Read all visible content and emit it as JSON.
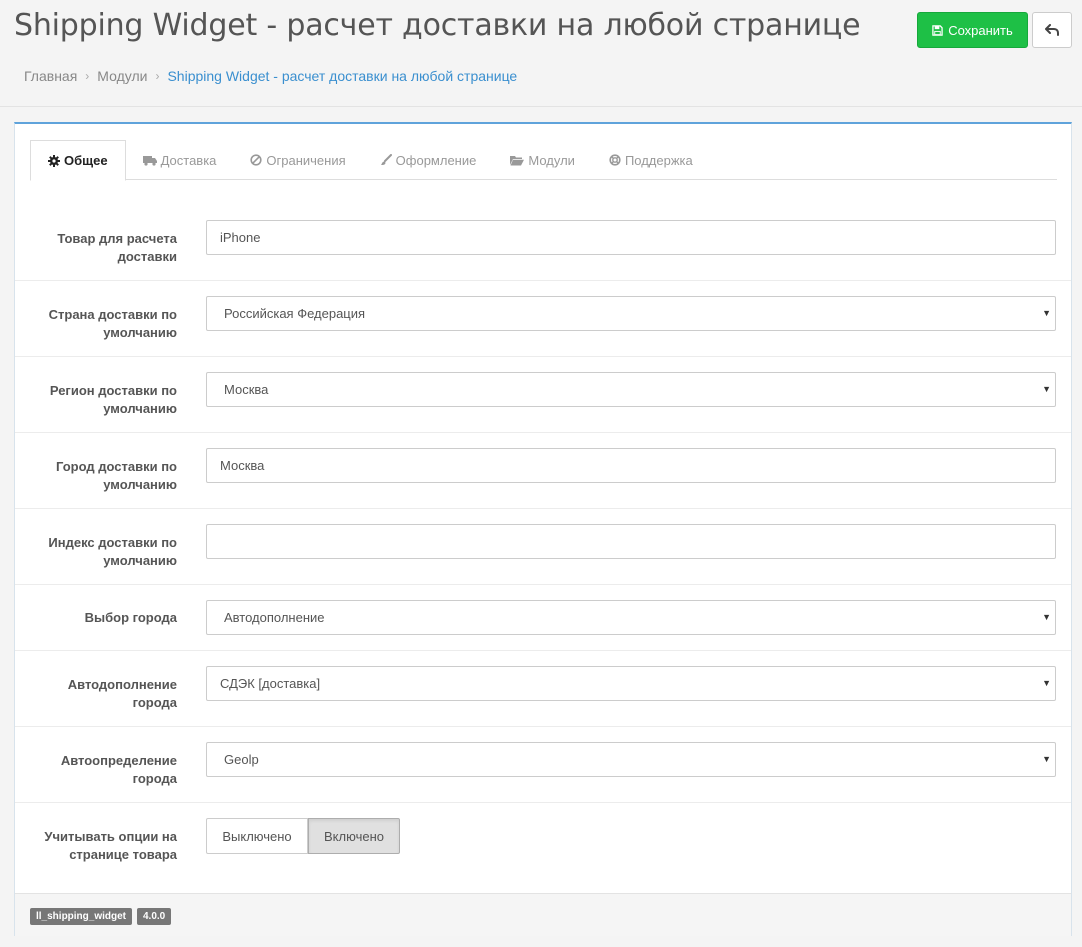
{
  "header": {
    "title": "Shipping Widget - расчет доставки на любой странице",
    "save_label": "Сохранить"
  },
  "breadcrumb": {
    "items": [
      "Главная",
      "Модули",
      "Shipping Widget - расчет доставки на любой странице"
    ]
  },
  "tabs": [
    {
      "label": "Общее",
      "icon": "gear-icon",
      "active": true
    },
    {
      "label": "Доставка",
      "icon": "truck-icon"
    },
    {
      "label": "Ограничения",
      "icon": "ban-icon"
    },
    {
      "label": "Оформление",
      "icon": "brush-icon"
    },
    {
      "label": "Модули",
      "icon": "folder-open-icon"
    },
    {
      "label": "Поддержка",
      "icon": "life-ring-icon"
    }
  ],
  "form": {
    "product": {
      "label": "Товар для расчета доставки",
      "value": "iPhone"
    },
    "country": {
      "label": "Страна доставки по умолчанию",
      "value": "Российская Федерация"
    },
    "region": {
      "label": "Регион доставки по умолчанию",
      "value": "Москва"
    },
    "city": {
      "label": "Город доставки по умолчанию",
      "value": "Москва"
    },
    "postcode": {
      "label": "Индекс доставки по умолчанию",
      "value": ""
    },
    "city_select": {
      "label": "Выбор города",
      "value": "Автодополнение"
    },
    "autocomplete": {
      "label": "Автодополнение города",
      "value": "СДЭК [доставка]"
    },
    "autodetect": {
      "label": "Автоопределение города",
      "value": "Geolp"
    },
    "product_options": {
      "label": "Учитывать опции на странице товара",
      "off_label": "Выключено",
      "on_label": "Включено",
      "selected": "Включено"
    }
  },
  "footer": {
    "module_code": "ll_shipping_widget",
    "version": "4.0.0"
  },
  "colors": {
    "save_button": "#1ec046",
    "accent_link": "#3a8fcf",
    "panel_top_border": "#5fa3db",
    "badge": "#777777"
  }
}
